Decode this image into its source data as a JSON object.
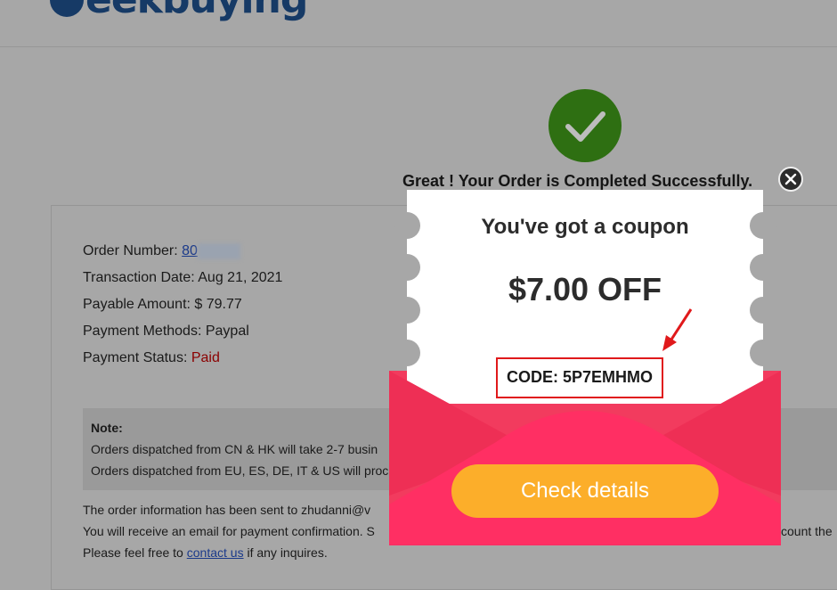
{
  "header": {
    "logo_text": "eekbuying"
  },
  "success": {
    "title": "Great ! Your Order is Completed Successfully.",
    "icon": "checkmark-icon",
    "color": "#2e6f12"
  },
  "order": {
    "number_label": "Order Number: ",
    "number_value": "80",
    "transaction_date": "Transaction Date: Aug 21, 2021",
    "payable_amount": "Payable Amount: $ 79.77",
    "payment_methods": "Payment Methods: Paypal",
    "payment_status_label": "Payment Status: ",
    "payment_status_value": "Paid"
  },
  "note": {
    "title": "Note:",
    "line1": "Orders dispatched from CN & HK will take 2-7 busin",
    "line2": "Orders dispatched from EU, ES, DE, IT & US will proc"
  },
  "footer": {
    "line1": "The order information has been sent to zhudanni@v",
    "line2": "You will receive an email for payment confirmation. S",
    "line3_prefix": "Please feel free to ",
    "line3_link": "contact us",
    "line3_suffix": " if any inquires.",
    "right_fragment": "ccount the"
  },
  "coupon": {
    "title": "You've got a coupon",
    "amount": "$7.00 OFF",
    "code": "CODE: 5P7EMHMO",
    "button": "Check details",
    "close_icon": "close-icon",
    "colors": {
      "envelope": "#f23b5e",
      "button": "#fcae2a",
      "highlight": "#e0191b"
    }
  }
}
